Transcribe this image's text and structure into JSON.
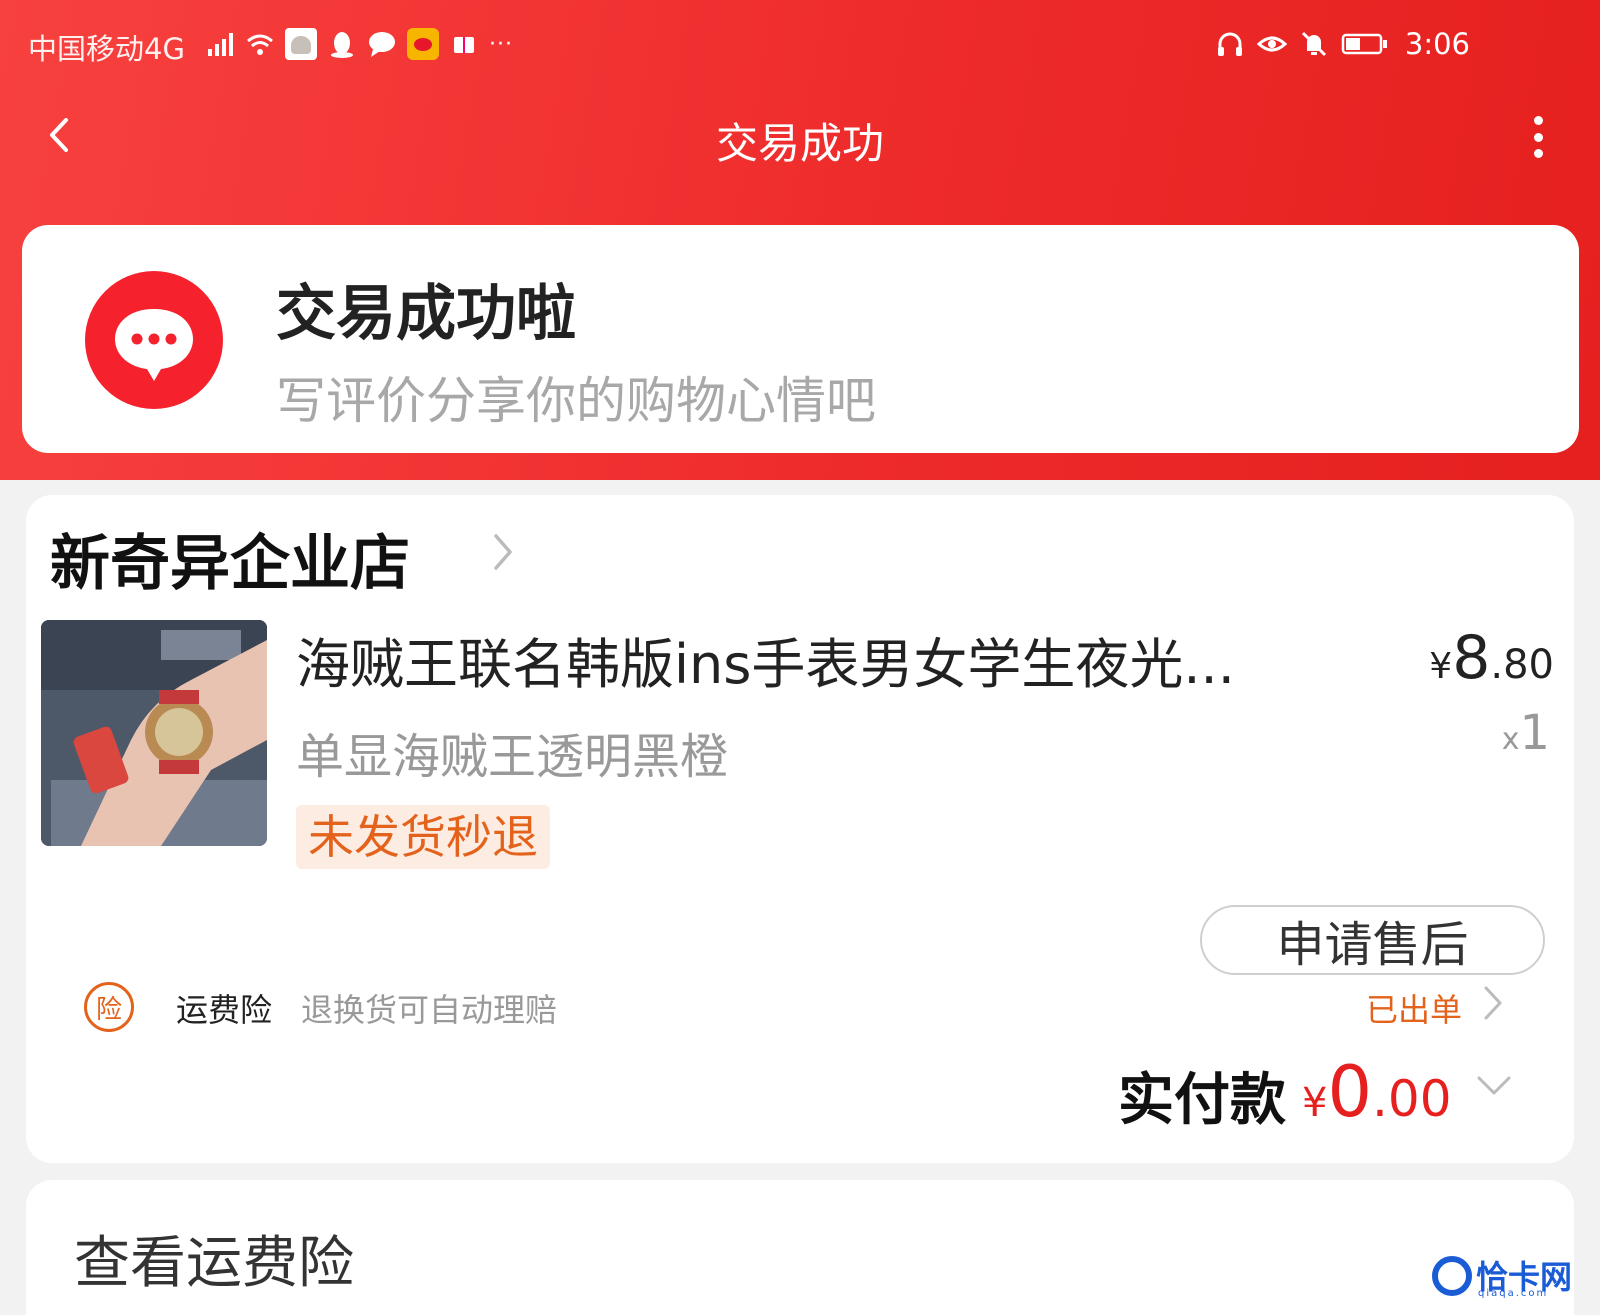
{
  "status_bar": {
    "carrier": "中国移动4G",
    "time": "3:06"
  },
  "nav": {
    "title": "交易成功"
  },
  "success": {
    "title": "交易成功啦",
    "subtitle": "写评价分享你的购物心情吧"
  },
  "order": {
    "shop_name": "新奇异企业店",
    "product": {
      "title": "海贼王联名韩版ins手表男女学生夜光...",
      "spec": "单显海贼王透明黑橙",
      "tag": "未发货秒退",
      "price_currency": "¥",
      "price_int": "8",
      "price_dec": ".80",
      "qty_prefix": "x",
      "qty": "1"
    },
    "after_sale_button": "申请售后",
    "insurance": {
      "icon_text": "险",
      "label": "运费险",
      "description": "退换货可自动理赔",
      "status": "已出单"
    },
    "paid": {
      "label": "实付款",
      "currency": "¥",
      "int": "0",
      "dec": ".00"
    }
  },
  "bottom": {
    "view_insurance": "查看运费险"
  },
  "watermark": {
    "text": "恰卡网",
    "small": "qiaqa.com"
  },
  "colors": {
    "header_red": "#ee2b2b",
    "accent_orange": "#e4631c",
    "price_red": "#e6201f"
  }
}
